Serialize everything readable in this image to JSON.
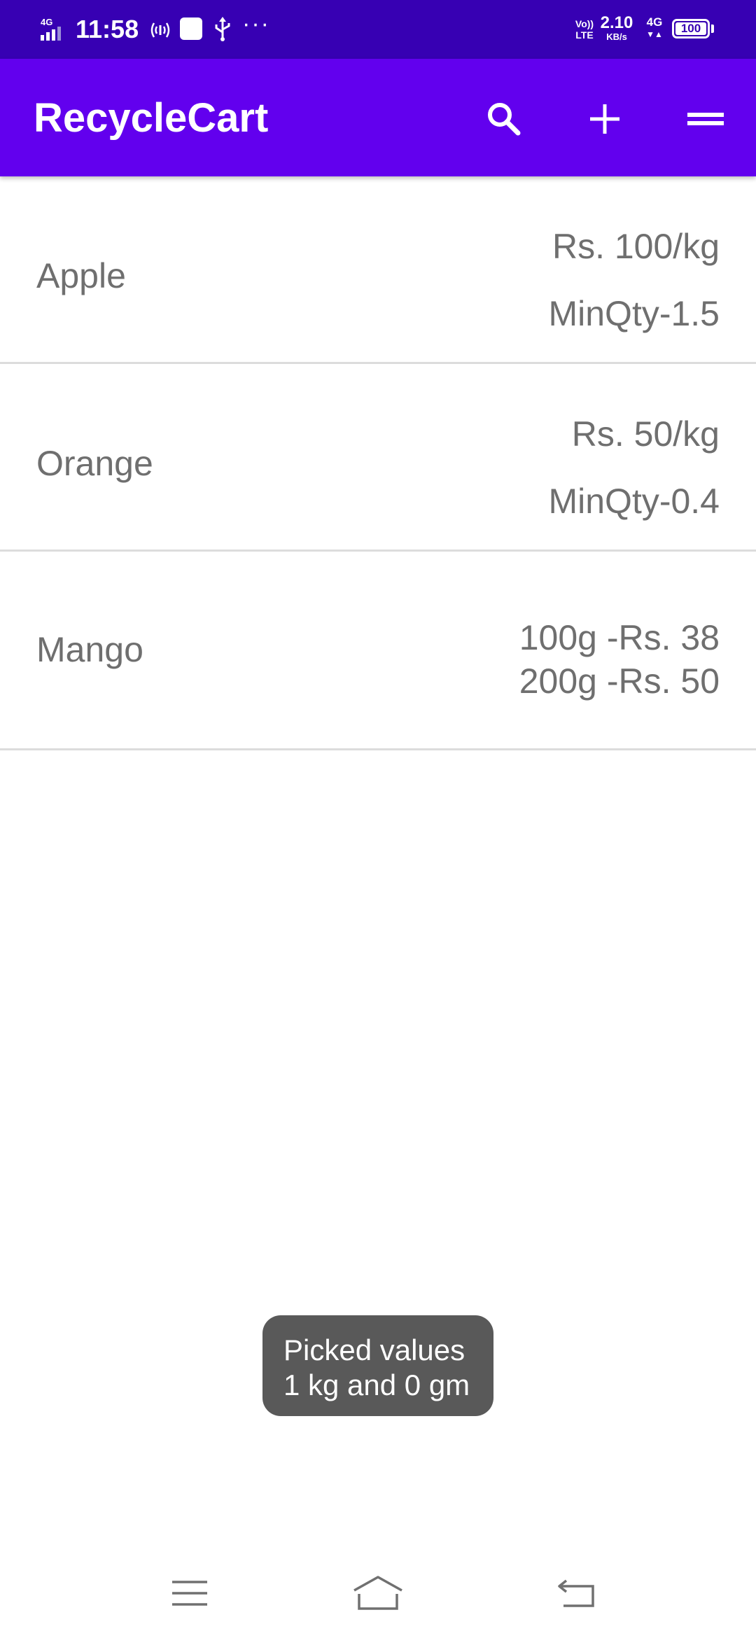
{
  "status_bar": {
    "network_type": "4G",
    "time": "11:58",
    "more": "···",
    "volte_top": "Vo))",
    "volte_bottom": "LTE",
    "speed": "2.10",
    "speed_unit": "KB/s",
    "net_label": "4G",
    "net_arrows": "▼▲",
    "battery": "100"
  },
  "app_bar": {
    "title": "RecycleCart",
    "actions": [
      "search-icon",
      "add-icon",
      "menu-icon"
    ]
  },
  "products": [
    {
      "name": "Apple",
      "price": "Rs. 100/kg",
      "min_qty": "MinQty-1.5"
    },
    {
      "name": "Orange",
      "price": "Rs. 50/kg",
      "min_qty": "MinQty-0.4"
    },
    {
      "name": "Mango",
      "price_line_1": "100g -Rs. 38",
      "price_line_2": "200g -Rs. 50"
    }
  ],
  "toast": {
    "line_1": "Picked values",
    "line_2": "1 kg and 0 gm"
  },
  "nav_bar": {
    "buttons": [
      "menu-icon",
      "home-icon",
      "back-icon"
    ]
  },
  "colors": {
    "status_bar": "#3700b3",
    "app_bar": "#6200ee",
    "list_text": "#6f6f6f",
    "divider": "#dcdcdc",
    "toast_bg": "#595959"
  }
}
